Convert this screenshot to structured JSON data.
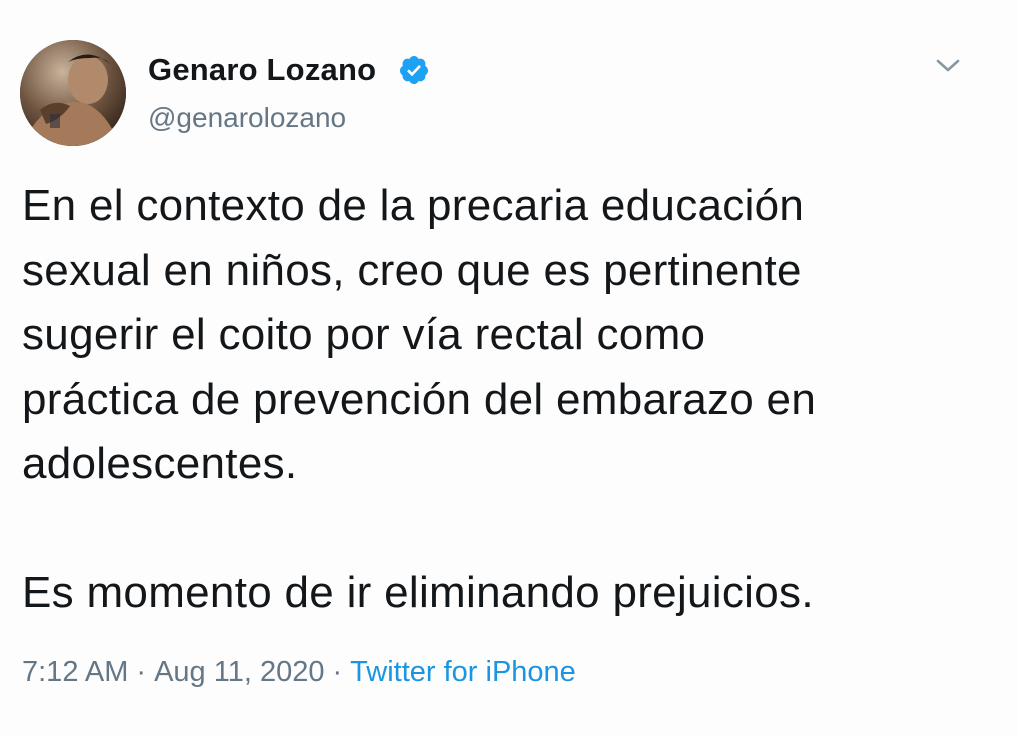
{
  "tweet": {
    "author_name": "Genaro Lozano",
    "handle": "@genarolozano",
    "avatar": "profile-photo",
    "verified_icon": "verified-badge-icon",
    "menu_icon": "chevron-down-icon",
    "text_paragraphs": [
      "En el contexto de la precaria educación\nsexual en niños, creo que es pertinente\nsugerir el coito por vía rectal como\npráctica de prevención del embarazo en\nadolescentes.",
      "Es momento de ir eliminando prejuicios."
    ],
    "time": "7:12 AM",
    "separator": "·",
    "date": "Aug 11, 2020",
    "source": "Twitter for iPhone",
    "colors": {
      "text": "#14171a",
      "secondary": "#657786",
      "link": "#1b95e0",
      "verified": "#1da1f2"
    }
  }
}
